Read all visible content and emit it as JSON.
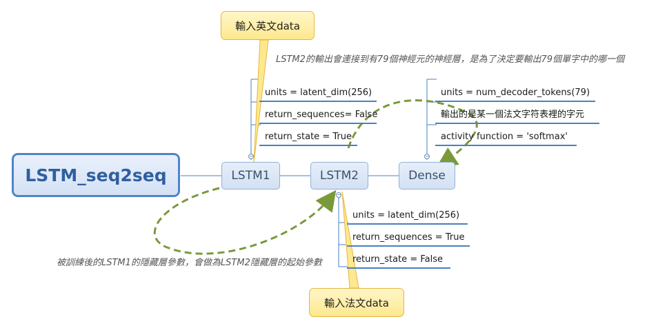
{
  "root": {
    "label": "LSTM_seq2seq"
  },
  "nodes": {
    "lstm1": {
      "label": "LSTM1"
    },
    "lstm2": {
      "label": "LSTM2"
    },
    "dense": {
      "label": "Dense"
    }
  },
  "lstm1_params": [
    "units = latent_dim(256)",
    "return_sequences= False",
    "return_state = True"
  ],
  "lstm2_params": [
    "units = latent_dim(256)",
    "return_sequences = True",
    "return_state = False"
  ],
  "dense_params": [
    "units = num_decoder_tokens(79)",
    "輸出的是某一個法文字符表裡的字元",
    "activity function = 'softmax'"
  ],
  "callouts": {
    "english_input": "輸入英文data",
    "french_input": "輸入法文data"
  },
  "notes": {
    "dense_note": "LSTM2的輸出會連接到有79個神經元的神經層，是為了決定要輸出79個單字中的哪一個",
    "state_note": "被訓練後的LSTM1的隱藏層參數，會做為LSTM2隱藏層的起始參數"
  },
  "colors": {
    "connector": "#4a7fc1",
    "relationship": "#7a9a3a",
    "callout_fill": "#fde88f"
  }
}
